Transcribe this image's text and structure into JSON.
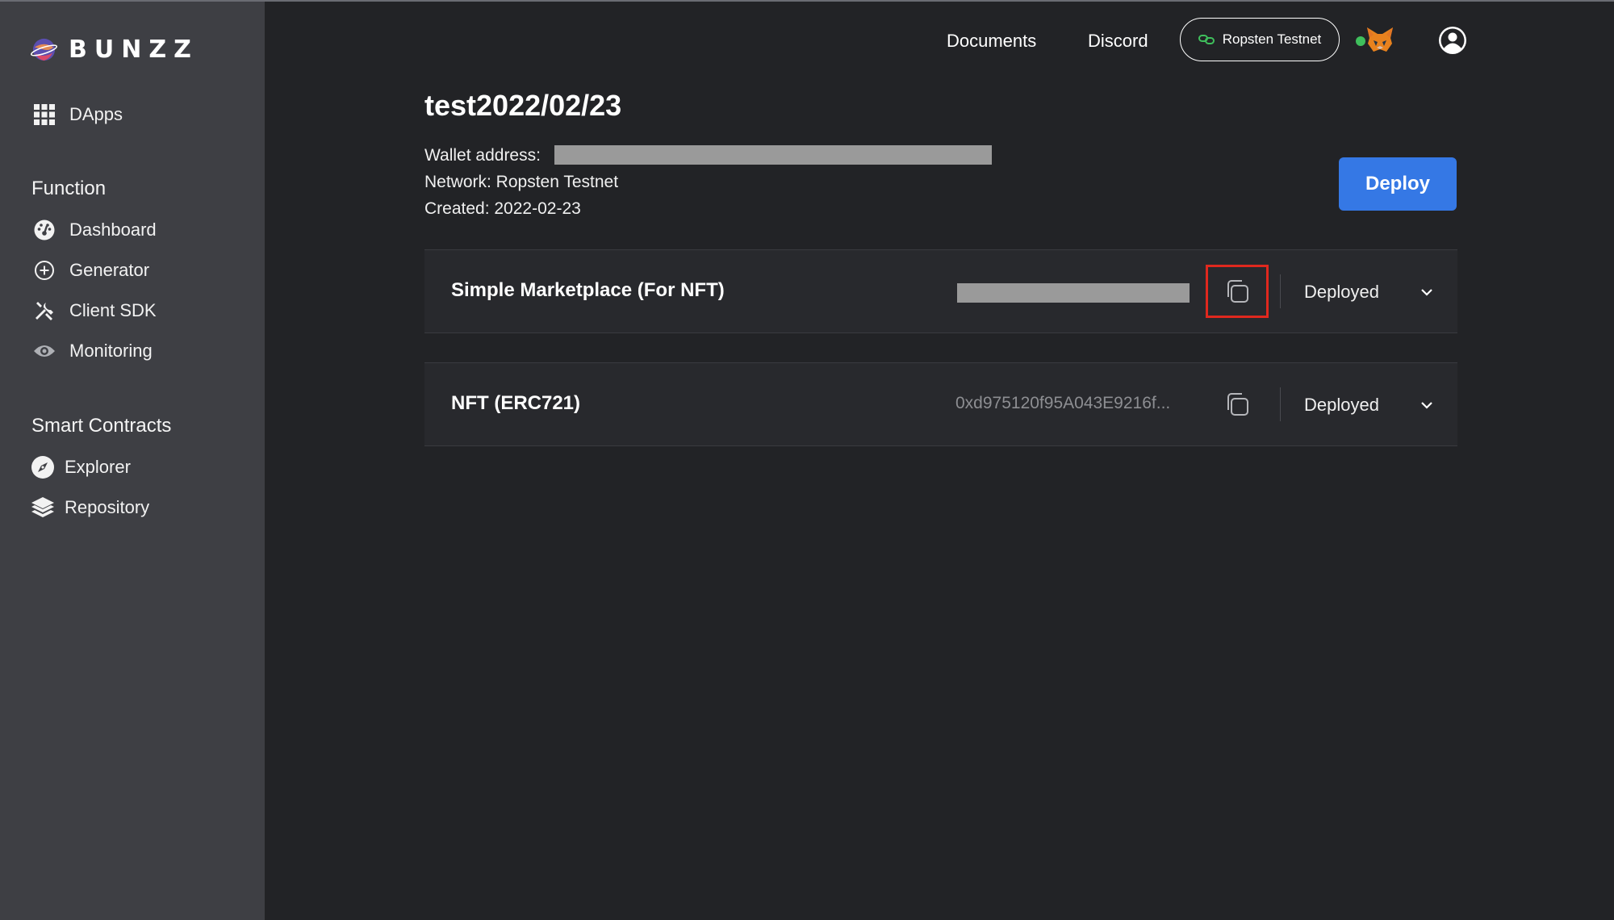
{
  "brand": {
    "name": "BUNZZ"
  },
  "sidebar": {
    "top_item": {
      "label": "DApps",
      "icon": "grid-icon"
    },
    "sections": [
      {
        "title": "Function",
        "items": [
          {
            "label": "Dashboard",
            "icon": "gauge-icon"
          },
          {
            "label": "Generator",
            "icon": "plus-circle-icon"
          },
          {
            "label": "Client SDK",
            "icon": "tools-icon"
          },
          {
            "label": "Monitoring",
            "icon": "eye-icon"
          }
        ]
      },
      {
        "title": "Smart Contracts",
        "items": [
          {
            "label": "Explorer",
            "icon": "compass-icon"
          },
          {
            "label": "Repository",
            "icon": "layers-icon"
          }
        ]
      }
    ]
  },
  "header": {
    "links": [
      "Documents",
      "Discord"
    ],
    "network": "Ropsten Testnet",
    "connected_status_color": "#3fbf5c"
  },
  "dapp": {
    "title": "test2022/02/23",
    "wallet_label": "Wallet address:",
    "network_line": "Network: Ropsten Testnet",
    "created_line": "Created: 2022-02-23",
    "deploy_label": "Deploy"
  },
  "contracts": [
    {
      "name": "Simple Marketplace (For NFT)",
      "address": "",
      "address_redacted": true,
      "status": "Deployed",
      "copy_highlighted": true
    },
    {
      "name": "NFT (ERC721)",
      "address": "0xd975120f95A043E9216f...",
      "address_redacted": false,
      "status": "Deployed",
      "copy_highlighted": false
    }
  ],
  "colors": {
    "accent": "#3578e5",
    "highlight": "#e0281e",
    "sidebar": "#3e3f44",
    "background": "#222326"
  }
}
